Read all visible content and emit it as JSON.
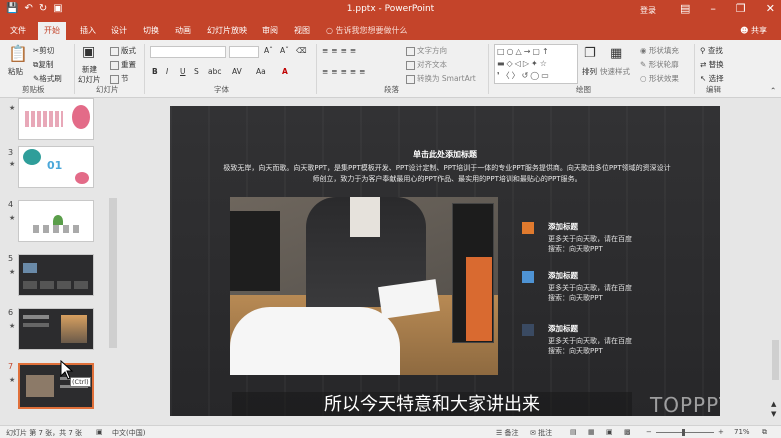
{
  "window": {
    "title": "1.pptx - PowerPoint",
    "login": "登录",
    "share": "共享"
  },
  "tabs": [
    {
      "label": "文件"
    },
    {
      "label": "开始"
    },
    {
      "label": "插入"
    },
    {
      "label": "设计"
    },
    {
      "label": "切换"
    },
    {
      "label": "动画"
    },
    {
      "label": "幻灯片放映"
    },
    {
      "label": "审阅"
    },
    {
      "label": "视图"
    }
  ],
  "tell_me": "告诉我您想要做什么",
  "ribbon": {
    "clipboard": {
      "paste": "粘贴",
      "cut": "剪切",
      "copy": "复制",
      "format_painter": "格式刷",
      "group": "剪贴板"
    },
    "slides": {
      "new_slide": "新建",
      "new_slide2": "幻灯片",
      "layout": "版式",
      "reset": "重置",
      "section": "节",
      "group": "幻灯片"
    },
    "font": {
      "group": "字体",
      "bold": "B",
      "italic": "I",
      "underline": "U",
      "strike": "S",
      "shadow": "abc",
      "spacing": "AV",
      "case": "Aa",
      "color": "A"
    },
    "paragraph": {
      "group": "段落",
      "text_direction": "文字方向",
      "align_text": "对齐文本",
      "smartart": "转换为 SmartArt"
    },
    "drawing": {
      "group": "绘图",
      "arrange": "排列",
      "quick_styles": "快速样式",
      "fill": "形状填充",
      "outline": "形状轮廓",
      "effects": "形状效果"
    },
    "editing": {
      "group": "编辑",
      "find": "查找",
      "replace": "替换",
      "select": "选择"
    }
  },
  "thumbnails": [
    {
      "num": "3"
    },
    {
      "num": "4"
    },
    {
      "num": "5"
    },
    {
      "num": "6"
    },
    {
      "num": "7"
    }
  ],
  "slide": {
    "title": "单击此处添加标题",
    "description": "极致无岸，向天而歌。向天歌PPT，是集PPT模板开发、PPT设计定制、PPT培训于一体的专业PPT服务提供商。向天歌由多位PPT领域的资深设计师创立，致力于为客户奉献最用心的PPT作品、最实用的PPT培训和最贴心的PPT服务。",
    "items": [
      {
        "heading": "添加标题",
        "line1": "更多关于向天歌，请在百度",
        "line2": "搜索：向天歌PPT",
        "color": "#e07a2e"
      },
      {
        "heading": "添加标题",
        "line1": "更多关于向天歌，请在百度",
        "line2": "搜索：向天歌PPT",
        "color": "#4e93d4"
      },
      {
        "heading": "添加标题",
        "line1": "更多关于向天歌，请在百度",
        "line2": "搜索：向天歌PPT",
        "color": "#3a4a62"
      }
    ]
  },
  "subtitle": "所以今天特意和大家讲出来",
  "watermark": "TOPPPT.CN",
  "ctrl_tag": "(Ctrl)",
  "status": {
    "slide_info": "幻灯片 第 7 张，共 7 张",
    "language": "中文(中国)",
    "notes": "备注",
    "comments": "批注",
    "zoom": "71%"
  }
}
